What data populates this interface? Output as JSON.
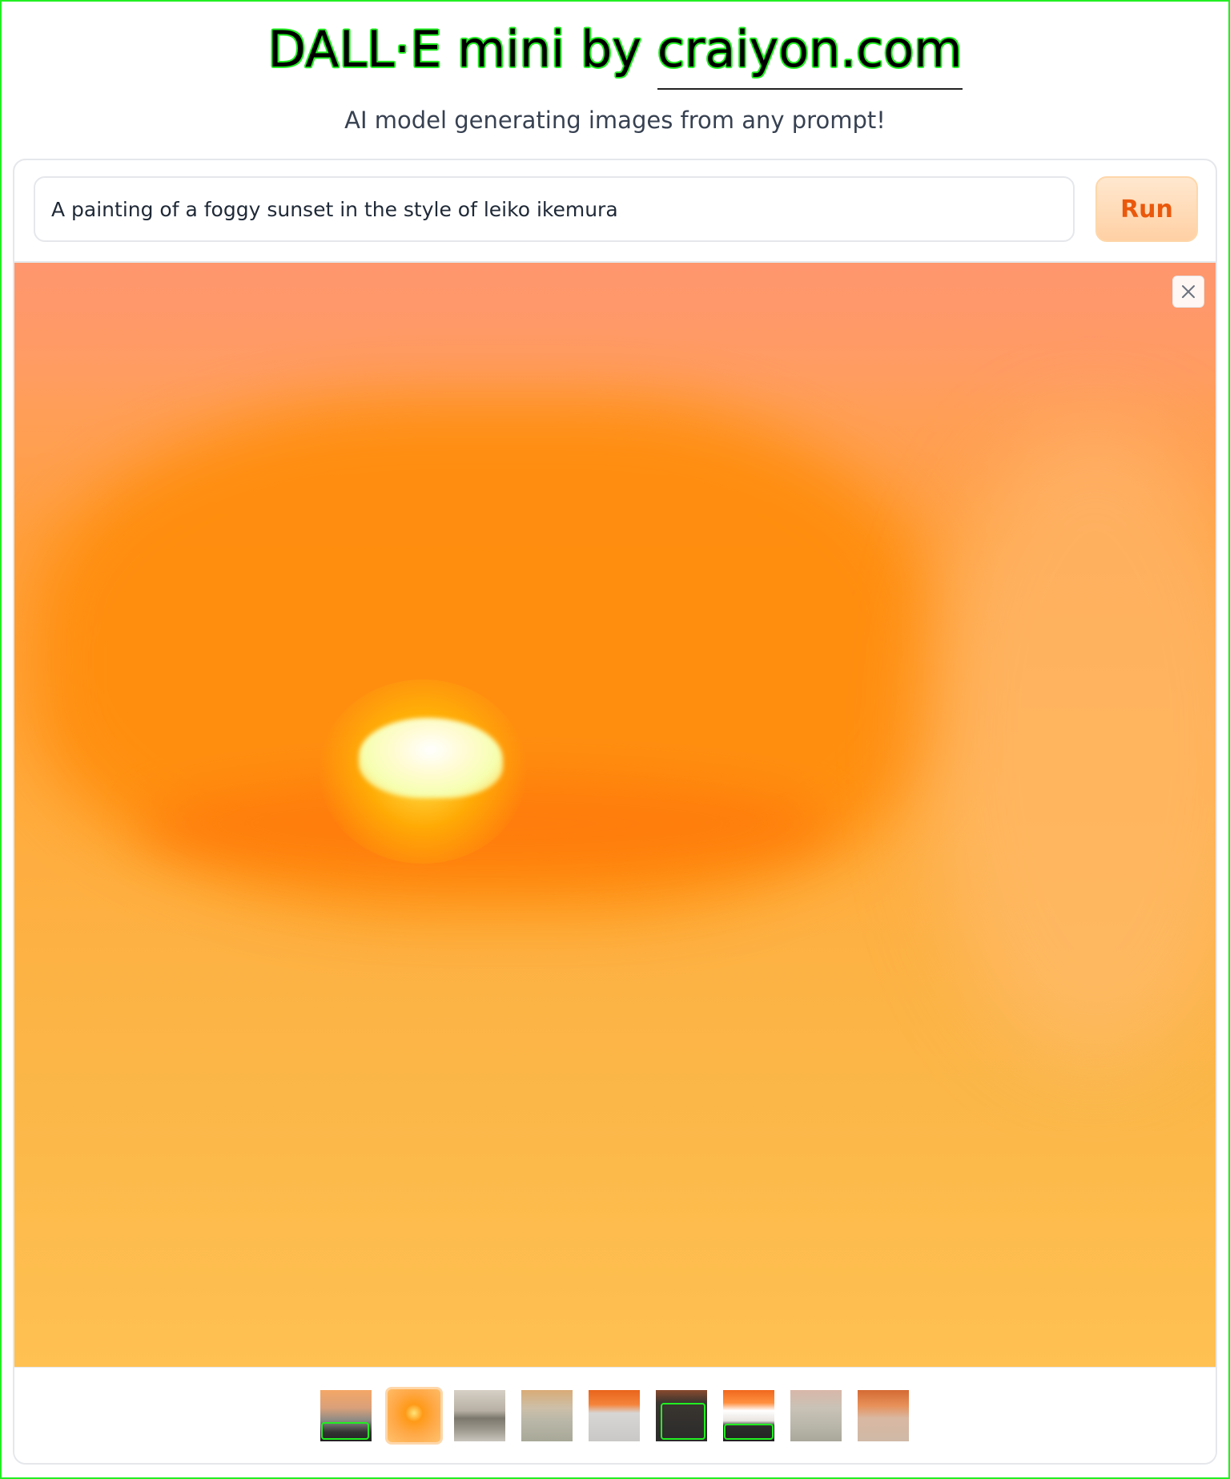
{
  "header": {
    "title_prefix": "DALL·E mini by ",
    "title_link": "craiyon.com",
    "subtitle": "AI model generating images from any prompt!"
  },
  "prompt": {
    "value": "A painting of a foggy sunset in the style of leiko ikemura"
  },
  "run_button": {
    "label": "Run"
  },
  "gallery": {
    "close_icon": "close-icon",
    "thumbnail_count": 9,
    "selected_index": 1
  },
  "colors": {
    "accent": "#ea580c",
    "accent_light": "#fed7aa",
    "highlight_outline": "#22ee22",
    "border": "#e5e7eb"
  }
}
